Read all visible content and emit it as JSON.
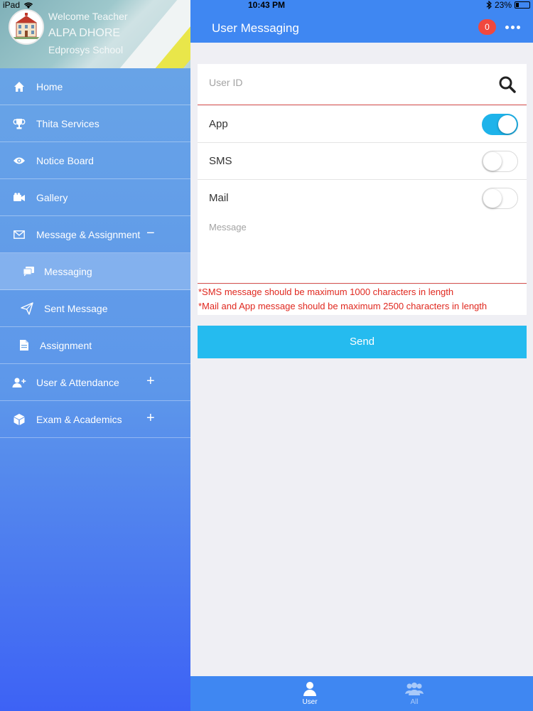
{
  "status_bar": {
    "device": "iPad",
    "time": "10:43 PM",
    "battery_percent": "23%"
  },
  "profile": {
    "welcome": "Welcome Teacher",
    "name": "ALPA DHORE",
    "school": "Edprosys School"
  },
  "sidebar": {
    "items": [
      {
        "label": "Home",
        "icon": "home-icon"
      },
      {
        "label": "Thita Services",
        "icon": "trophy-icon"
      },
      {
        "label": "Notice Board",
        "icon": "eye-icon"
      },
      {
        "label": "Gallery",
        "icon": "video-camera-icon"
      },
      {
        "label": "Message & Assignment",
        "icon": "envelope-icon",
        "toggle": "−"
      },
      {
        "label": "Messaging",
        "icon": "chat-icon",
        "active": true
      },
      {
        "label": "Sent Message",
        "icon": "send-icon"
      },
      {
        "label": "Assignment",
        "icon": "document-icon"
      },
      {
        "label": "User & Attendance",
        "icon": "add-user-icon",
        "toggle": "+"
      },
      {
        "label": "Exam & Academics",
        "icon": "cube-icon",
        "toggle": "+"
      }
    ]
  },
  "header": {
    "title": "User Messaging",
    "notification_count": "0"
  },
  "form": {
    "user_id_placeholder": "User ID",
    "toggles": [
      {
        "label": "App",
        "on": true
      },
      {
        "label": "SMS",
        "on": false
      },
      {
        "label": "Mail",
        "on": false
      }
    ],
    "message_placeholder": "Message",
    "warning_sms": "*SMS message should be maximum 1000 characters in length",
    "warning_mail": "*Mail and App message should be maximum 2500 characters in length",
    "send_label": "Send"
  },
  "tabs": [
    {
      "label": "User",
      "icon": "user-icon",
      "active": true
    },
    {
      "label": "All",
      "icon": "group-icon",
      "active": false
    }
  ],
  "colors": {
    "header": "#3f87f2",
    "accent": "#25bbef",
    "warning": "#e0281f",
    "badge": "#f0483e"
  }
}
